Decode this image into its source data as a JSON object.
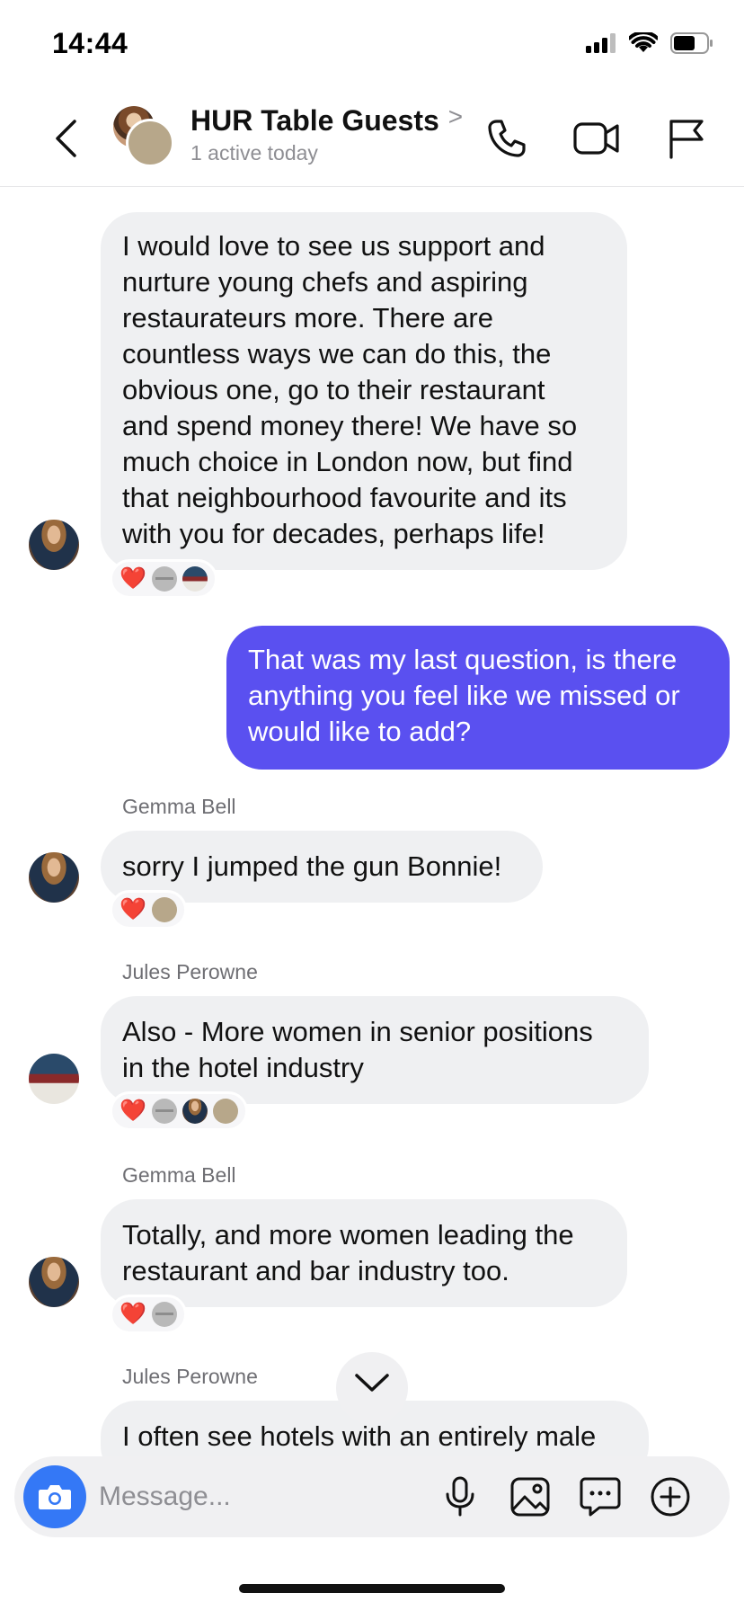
{
  "status_bar": {
    "time": "14:44"
  },
  "header": {
    "title": "HUR Table Guests",
    "chevron": ">",
    "subtitle": "1 active today"
  },
  "messages": [
    {
      "lines": [
        "I would love to see us support and",
        "nurture young chefs and aspiring",
        "restaurateurs more. There are",
        "countless ways we can do this, the",
        "obvious one, go to their restaurant",
        "and spend money there! We have so",
        "much choice in London now, but find",
        "that neighbourhood favourite and its",
        "with you for decades, perhaps life!"
      ],
      "reaction": "❤️"
    },
    {
      "lines": [
        "That was my last question, is there",
        "anything you feel like we missed or",
        "would like to add?"
      ]
    },
    {
      "sender": "Gemma Bell",
      "lines": [
        "sorry I jumped the gun Bonnie!"
      ],
      "reaction": "❤️"
    },
    {
      "sender": "Jules Perowne",
      "lines": [
        "Also - More women in senior positions",
        "in the hotel industry"
      ],
      "reaction": "❤️"
    },
    {
      "sender": "Gemma Bell",
      "lines": [
        "Totally, and more women leading the",
        "restaurant and bar industry too."
      ],
      "reaction": "❤️"
    },
    {
      "sender": "Jules Perowne",
      "lines": [
        "I often see hotels with an entirely male"
      ]
    }
  ],
  "composer": {
    "placeholder": "Message..."
  },
  "colors": {
    "outgoing_bubble": "#5a50f0",
    "incoming_bubble": "#eff0f2",
    "camera_button": "#3478f6",
    "reaction_heart": "#e5202a"
  },
  "icons": {
    "header": [
      "back-icon",
      "phone-icon",
      "video-icon",
      "flag-icon"
    ],
    "composer": [
      "camera-icon",
      "microphone-icon",
      "image-icon",
      "sticker-icon",
      "plus-icon"
    ]
  }
}
